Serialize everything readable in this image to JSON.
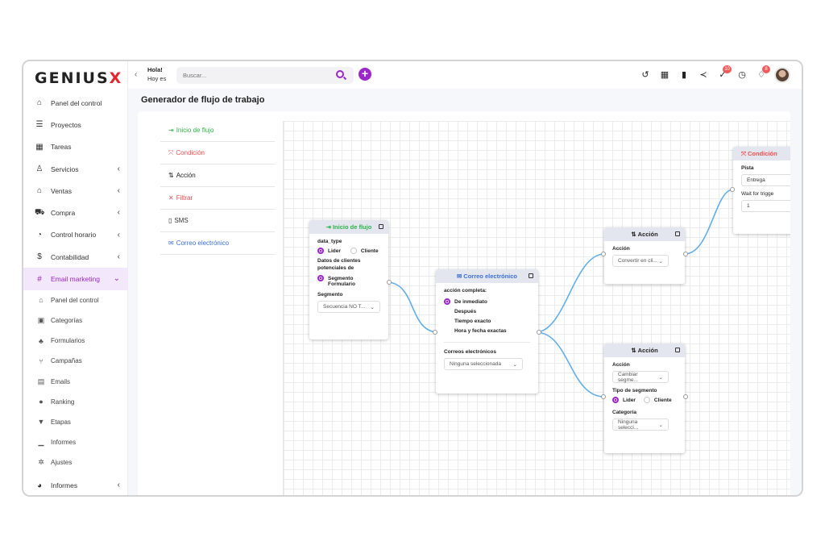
{
  "app": {
    "logo_text": "GENIUS",
    "logo_x": "X"
  },
  "colors": {
    "brand": "#9b27c9",
    "accent_red": "#e0262e",
    "start_green": "#2fb24a",
    "condition_red": "#f04e4e",
    "email_blue": "#3b6fd8",
    "link_blue": "#62b0e8"
  },
  "header": {
    "hola": "Hola!",
    "hoy": "Hoy es",
    "search_placeholder": "Buscar...",
    "badges": {
      "tasks": "10",
      "notifications": "8"
    }
  },
  "sidebar": {
    "items": [
      {
        "label": "Panel del control",
        "icon": "home-icon",
        "glyph": "⌂"
      },
      {
        "label": "Proyectos",
        "icon": "list-icon",
        "glyph": "☰"
      },
      {
        "label": "Tareas",
        "icon": "grid-icon",
        "glyph": "▦"
      },
      {
        "label": "Servicios",
        "icon": "services-icon",
        "glyph": "♙"
      },
      {
        "label": "Ventas",
        "icon": "bank-icon",
        "glyph": "⌂"
      },
      {
        "label": "Compra",
        "icon": "cart-icon",
        "glyph": "⛟"
      },
      {
        "label": "Control horario",
        "icon": "clock-icon",
        "glyph": "◔"
      },
      {
        "label": "Contabilidad",
        "icon": "dollar-icon",
        "glyph": "$"
      },
      {
        "label": "Email marketing",
        "icon": "hash-icon",
        "glyph": "#"
      }
    ],
    "sub_items": [
      {
        "label": "Panel del control",
        "icon": "home-icon",
        "glyph": "⌂"
      },
      {
        "label": "Categorías",
        "icon": "category-icon",
        "glyph": "▣"
      },
      {
        "label": "Formularios",
        "icon": "forms-icon",
        "glyph": "♣"
      },
      {
        "label": "Campañas",
        "icon": "campaign-icon",
        "glyph": "⑂"
      },
      {
        "label": "Emails",
        "icon": "email-icon",
        "glyph": "▤"
      },
      {
        "label": "Ranking",
        "icon": "ranking-icon",
        "glyph": "●"
      },
      {
        "label": "Etapas",
        "icon": "funnel-icon",
        "glyph": "▼"
      },
      {
        "label": "Informes",
        "icon": "chart-icon",
        "glyph": "▁"
      },
      {
        "label": "Ajustes",
        "icon": "settings-icon",
        "glyph": "✲"
      }
    ],
    "bottom_item": {
      "label": "Informes",
      "icon": "pie-icon",
      "glyph": "◕"
    }
  },
  "main": {
    "title": "Generador de flujo de trabajo"
  },
  "palette": [
    {
      "label": "Inicio de flujo",
      "icon": "flow-start-icon",
      "glyph": "⇥",
      "color": "#2fb24a"
    },
    {
      "label": "Condición",
      "icon": "condition-icon",
      "glyph": "⤧",
      "color": "#f04e4e"
    },
    {
      "label": "Acción",
      "icon": "action-icon",
      "glyph": "⇅",
      "color": "#222222"
    },
    {
      "label": "Filtrar",
      "icon": "filter-icon",
      "glyph": "✕",
      "color": "#f04e4e"
    },
    {
      "label": "SMS",
      "icon": "sms-icon",
      "glyph": "▯",
      "color": "#333333"
    },
    {
      "label": "Correo electrónico",
      "icon": "mail-icon",
      "glyph": "✉",
      "color": "#3b6fd8"
    }
  ],
  "nodes": {
    "inicio": {
      "title": "Inicio de flujo",
      "data_type_label": "data_type",
      "opt1": "Lider",
      "opt2": "Cliente",
      "datos_label": "Datos de clientes potenciales de",
      "opt3": "Segmento",
      "opt4": "Formulario",
      "segmento_label": "Segmento",
      "segmento_value": "Secuencia NO T..."
    },
    "correo": {
      "title": "Correo electrónico",
      "accion_label": "acción completa:",
      "options": [
        "De inmediato",
        "Después",
        "Tiempo exacto",
        "Hora y fecha exactas"
      ],
      "correos_label": "Correos electrónicos",
      "correos_value": "Ninguna seleccionada"
    },
    "accion1": {
      "title": "Acción",
      "accion_label": "Acción",
      "accion_value": "Convertir en cli..."
    },
    "accion2": {
      "title": "Acción",
      "accion_label": "Acción",
      "accion_value": "Cambiar segme...",
      "tipo_label": "Tipo de segmento",
      "opt1": "Lider",
      "opt2": "Cliente",
      "categoria_label": "Categoría",
      "categoria_value": "Ninguna selecci..."
    },
    "condicion": {
      "title": "Condición",
      "pista_label": "Pista",
      "pista_value": "Entrega",
      "wait_label": "Wait for trigge",
      "wait_value": "1"
    }
  }
}
